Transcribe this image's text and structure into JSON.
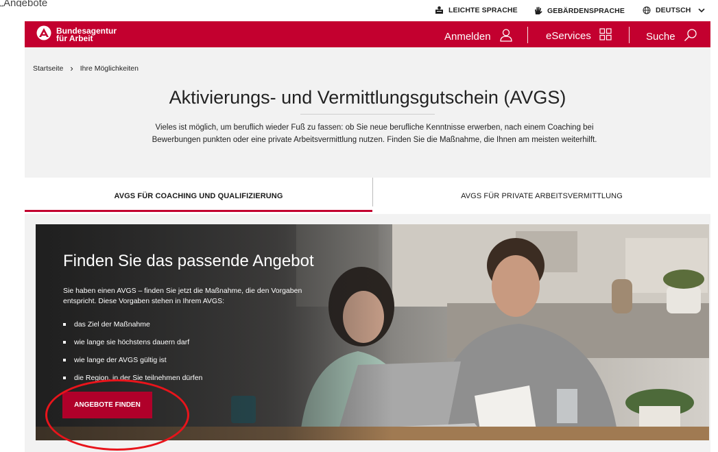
{
  "top_fragment": "„Angebote",
  "utility": {
    "easy_language": "LEICHTE SPRACHE",
    "sign_language": "GEBÄRDENSPRACHE",
    "language": "DEUTSCH"
  },
  "header": {
    "logo_line1": "Bundesagentur",
    "logo_line2": "für Arbeit",
    "login": "Anmelden",
    "eservices": "eServices",
    "search": "Suche",
    "brand_color": "#c3002f"
  },
  "breadcrumb": {
    "home": "Startseite",
    "separator": "›",
    "current": "Ihre Möglichkeiten"
  },
  "page": {
    "title": "Aktivierungs- und Vermittlungsgutschein (AVGS)",
    "intro_line1": "Vieles ist möglich, um beruflich wieder Fuß zu fassen: ob Sie neue berufliche Kenntnisse erwerben, nach einem Coaching bei",
    "intro_line2": "Bewerbungen punkten oder eine private Arbeitsvermittlung nutzen. Finden Sie die Maßnahme, die Ihnen am meisten weiterhilft."
  },
  "tabs": [
    {
      "label": "AVGS FÜR COACHING UND QUALIFIZIERUNG",
      "active": true
    },
    {
      "label": "AVGS FÜR PRIVATE ARBEITSVERMITTLUNG",
      "active": false
    }
  ],
  "hero": {
    "title": "Finden Sie das passende Angebot",
    "text_line1": "Sie haben einen AVGS – finden Sie jetzt die Maßnahme, die den Vorgaben",
    "text_line2": "entspricht. Diese Vorgaben stehen in Ihrem AVGS:",
    "list": [
      "das Ziel der Maßnahme",
      "wie lange sie höchstens dauern darf",
      "wie lange der AVGS gültig ist",
      "die Region, in der Sie teilnehmen dürfen"
    ],
    "cta": "ANGEBOTE FINDEN"
  }
}
